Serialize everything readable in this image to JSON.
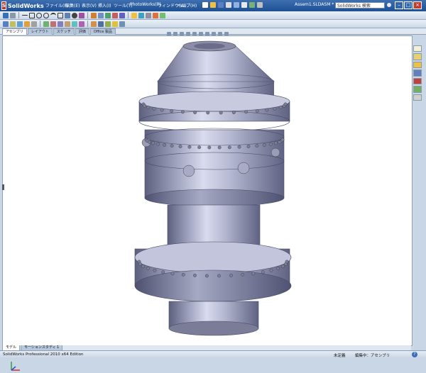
{
  "app": {
    "name": "SolidWorks",
    "document": "Assem1.SLDASM *",
    "search_placeholder": "SolidWorks 検索"
  },
  "menu": [
    "ファイル(F)",
    "編集(E)",
    "表示(V)",
    "挿入(I)",
    "ツール(T)",
    "PhotoWorks(P)",
    "ウィンドウ(W)",
    "ヘルプ(H)"
  ],
  "tabs": [
    {
      "label": "アセンブリ",
      "active": true
    },
    {
      "label": "レイアウト",
      "active": false
    },
    {
      "label": "スケッチ",
      "active": false
    },
    {
      "label": "評価",
      "active": false
    },
    {
      "label": "Office 製品",
      "active": false
    }
  ],
  "bottom_tabs": [
    {
      "label": "モデル",
      "active": true
    },
    {
      "label": "モーションスタディ 1",
      "active": false
    }
  ],
  "status": {
    "product": "SolidWorks Professional 2010 x64 Edition",
    "state": "未定義",
    "mode": "編集中：アセンブリ"
  },
  "colors": {
    "title": "#1d4f94",
    "model_light": "#c6c8de",
    "model_dark": "#6e7090",
    "accent_red": "#c8302a"
  },
  "icons": [
    "solidworks-logo-icon",
    "new-icon",
    "open-icon",
    "save-icon",
    "print-icon",
    "undo-icon",
    "rebuild-icon",
    "options-icon",
    "help-icon"
  ]
}
